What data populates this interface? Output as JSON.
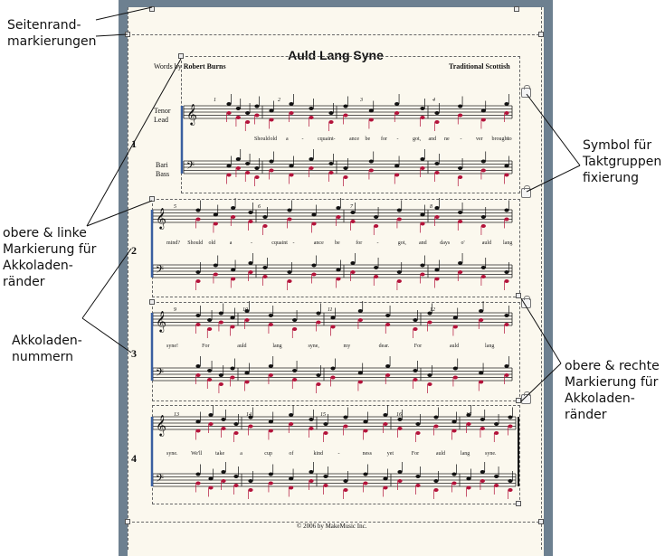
{
  "score": {
    "title": "Auld Lang Syne",
    "words_by_prefix": "Words by ",
    "words_by_name": "Robert Burns",
    "composer": "Traditional Scottish",
    "copyright": "© 2006 by MakeMusic Inc."
  },
  "instruments": {
    "tenor": "Tenor",
    "lead": "Lead",
    "bari": "Bari",
    "bass": "Bass"
  },
  "system_numbers": [
    "1",
    "2",
    "3",
    "4"
  ],
  "measure_numbers": [
    "1",
    "2",
    "3",
    "4",
    "5",
    "6",
    "7",
    "8",
    "9",
    "10",
    "11",
    "12",
    "13",
    "14",
    "15",
    "16",
    "17"
  ],
  "lyrics": [
    [
      "Should",
      "old",
      "a",
      "-",
      "cquaint",
      "-",
      "ance",
      "be",
      "for",
      "-",
      "got,",
      "and",
      "ne",
      "-",
      "ver",
      "brought",
      "to"
    ],
    [
      "mind?",
      "Should",
      "old",
      "a",
      "-",
      "cquaint",
      "-",
      "ance",
      "be",
      "for",
      "-",
      "got,",
      "and",
      "days",
      "o'",
      "auld",
      "lang"
    ],
    [
      "syne!",
      "For",
      "auld",
      "lang",
      "syne,",
      "my",
      "dear.",
      "For",
      "auld",
      "lang"
    ],
    [
      "syne.",
      "We'll",
      "take",
      "a",
      "cup",
      "of",
      "kind",
      "-",
      "ness",
      "yet",
      "For",
      "auld",
      "lang",
      "syne."
    ]
  ],
  "callouts": {
    "page_margins": [
      "Seitenrand-",
      "markierungen"
    ],
    "system_top_left": [
      "obere & linke",
      "Markierung für",
      "Akkoladen-",
      "ränder"
    ],
    "system_numbers": [
      "Akkoladen-",
      "nummern"
    ],
    "lock_symbol": [
      "Symbol für",
      "Taktgruppen",
      "fixierung"
    ],
    "system_top_right": [
      "obere & rechte",
      "Markierung für",
      "Akkoladen-",
      "ränder"
    ]
  }
}
